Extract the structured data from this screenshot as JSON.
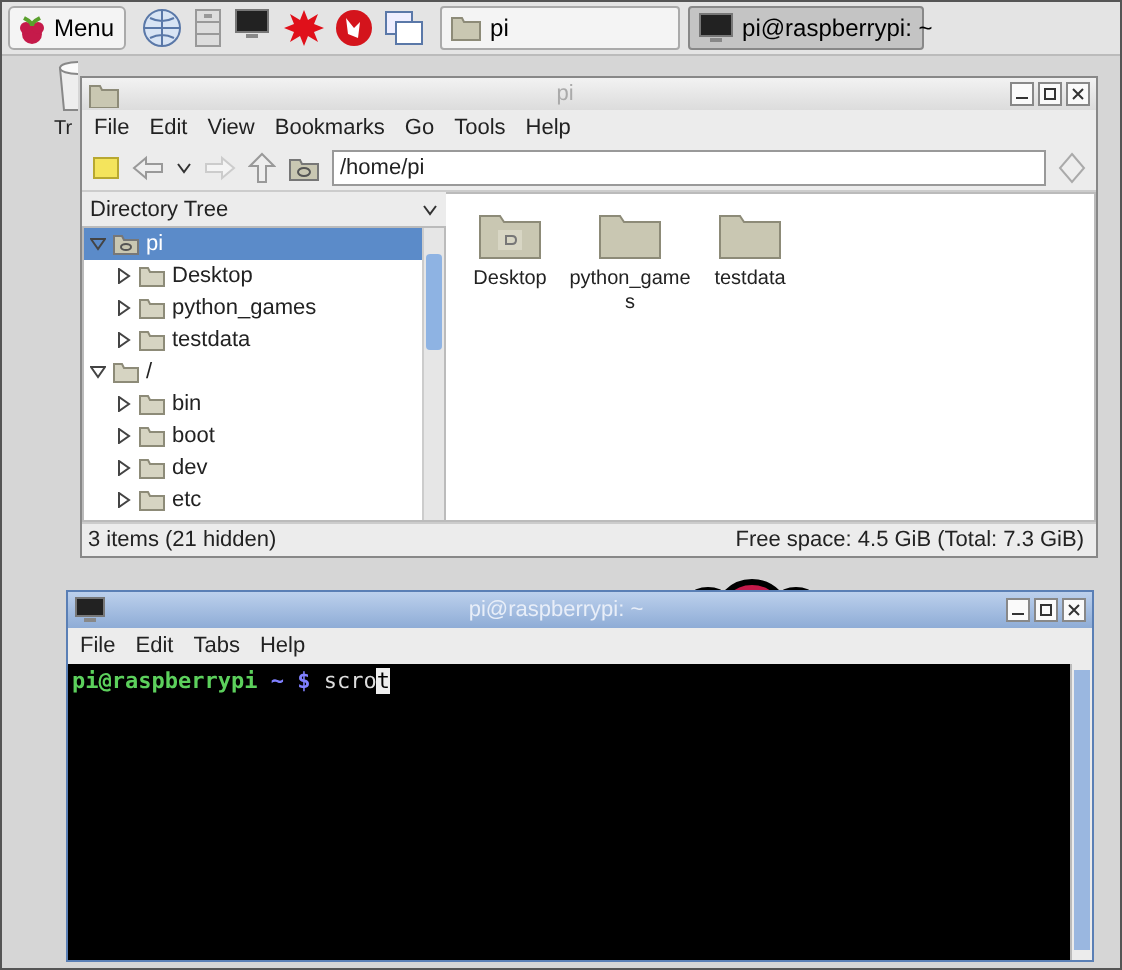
{
  "taskbar": {
    "menu_button": "Menu",
    "tasks": [
      {
        "label": "pi",
        "kind": "folder",
        "selected": false
      },
      {
        "label": "pi@raspberrypi: ~",
        "kind": "terminal",
        "selected": true
      }
    ]
  },
  "desktop": {
    "trash_label": "Tr"
  },
  "file_manager": {
    "title": "pi",
    "menu": [
      "File",
      "Edit",
      "View",
      "Bookmarks",
      "Go",
      "Tools",
      "Help"
    ],
    "path": "/home/pi",
    "sidebar_title": "Directory Tree",
    "tree": [
      {
        "label": "pi",
        "kind": "home",
        "expanded": true,
        "selected": true,
        "children": [
          {
            "label": "Desktop",
            "expanded": false,
            "selected": false
          },
          {
            "label": "python_games",
            "expanded": false,
            "selected": false
          },
          {
            "label": "testdata",
            "expanded": false,
            "selected": false
          }
        ]
      },
      {
        "label": "/",
        "kind": "folder",
        "expanded": true,
        "selected": false,
        "children": [
          {
            "label": "bin",
            "expanded": false,
            "selected": false
          },
          {
            "label": "boot",
            "expanded": false,
            "selected": false
          },
          {
            "label": "dev",
            "expanded": false,
            "selected": false
          },
          {
            "label": "etc",
            "expanded": false,
            "selected": false
          }
        ]
      }
    ],
    "files": [
      {
        "name": "Desktop",
        "kind": "desktop"
      },
      {
        "name": "python_game\ns",
        "kind": "folder"
      },
      {
        "name": "testdata",
        "kind": "folder"
      }
    ],
    "status_left": "3 items (21 hidden)",
    "status_right": "Free space: 4.5 GiB (Total: 7.3 GiB)"
  },
  "terminal": {
    "title": "pi@raspberrypi: ~",
    "menu": [
      "File",
      "Edit",
      "Tabs",
      "Help"
    ],
    "prompt_user": "pi@raspberrypi",
    "prompt_path": "~ $",
    "command": "scro",
    "cursor_char": "t"
  }
}
